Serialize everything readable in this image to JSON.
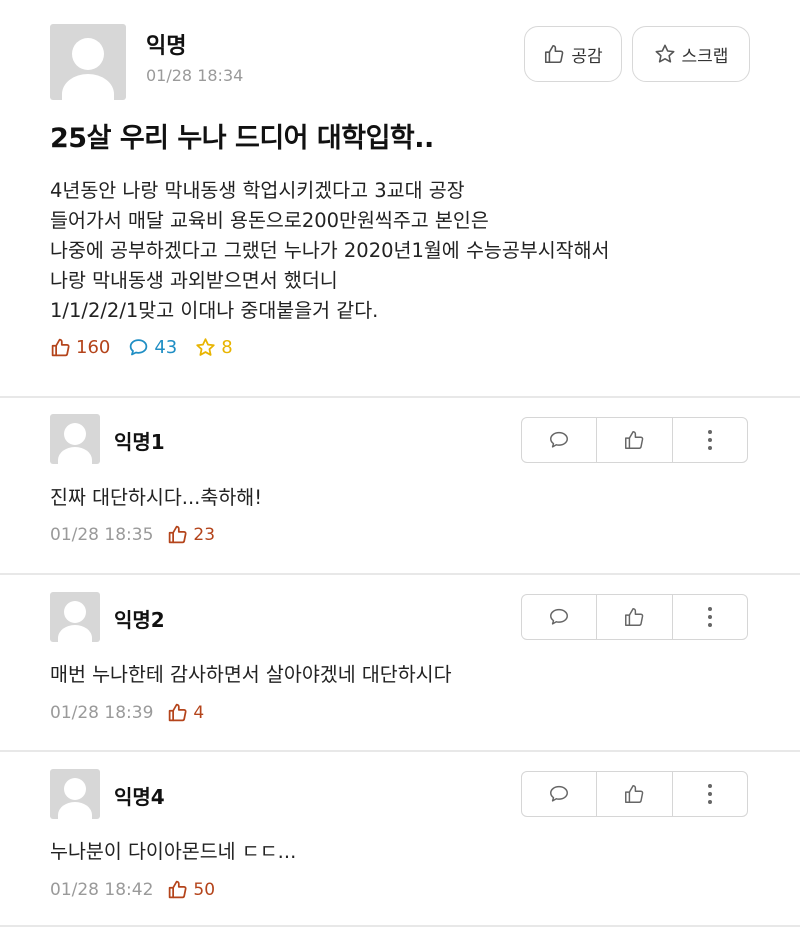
{
  "post": {
    "author": "익명",
    "time": "01/28 18:34",
    "empathy_label": "공감",
    "scrap_label": "스크랩",
    "title": "25살 우리 누나 드디어 대학입학..",
    "body_lines": [
      "4년동안 나랑 막내동생 학업시키겠다고 3교대 공장",
      "들어가서 매달 교육비 용돈으로200만원씩주고 본인은",
      "나중에 공부하겠다고 그랬던 누나가 2020년1월에 수능공부시작해서",
      "나랑 막내동생 과외받으면서 했더니",
      "1/1/2/2/1맞고 이대나 중대붙을거 같다."
    ],
    "likes": "160",
    "comments": "43",
    "scraps": "8"
  },
  "comments": [
    {
      "author": "익명1",
      "text": "진짜 대단하시다...축하해!",
      "time": "01/28 18:35",
      "likes": "23"
    },
    {
      "author": "익명2",
      "text": "매번 누나한테 감사하면서 살아야겠네 대단하시다",
      "time": "01/28 18:39",
      "likes": "4"
    },
    {
      "author": "익명4",
      "text": "누나분이 다이아몬드네 ㄷㄷ...",
      "time": "01/28 18:42",
      "likes": "50"
    }
  ],
  "colors": {
    "like": "#b4441b",
    "comment": "#1f8ec4",
    "scrap": "#e8b400",
    "muted": "#9a9a9a"
  },
  "icons": {
    "like": "thumbs-up-icon",
    "comment": "speech-bubble-icon",
    "scrap": "star-icon",
    "more": "vertical-ellipsis-icon"
  }
}
